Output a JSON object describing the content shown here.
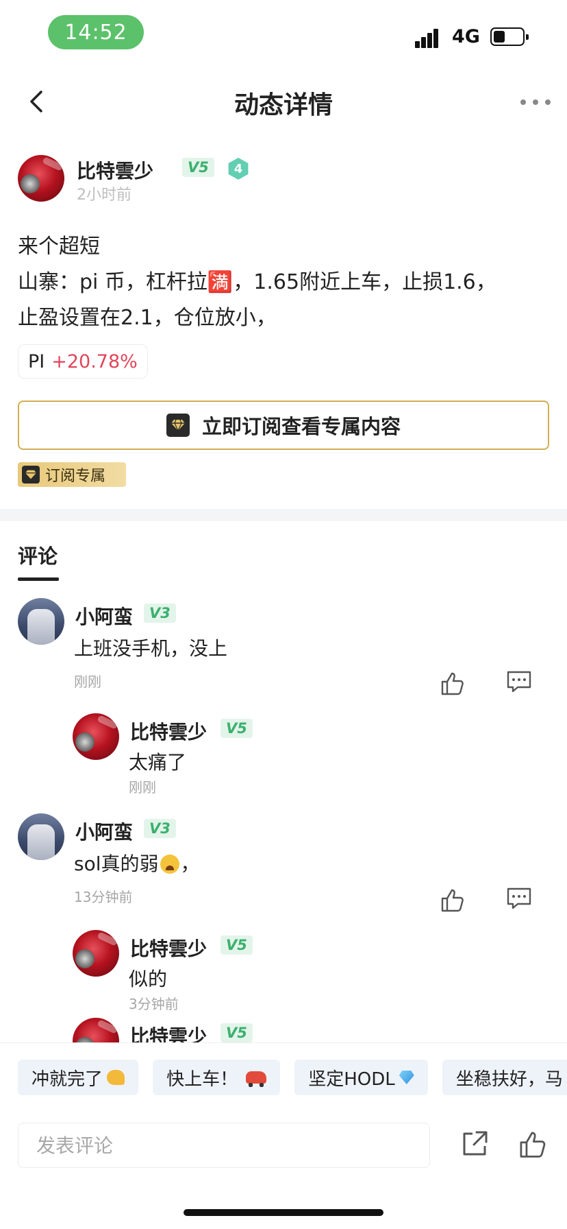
{
  "status_bar": {
    "time": "14:52",
    "network": "4G",
    "battery_percent": 40
  },
  "nav": {
    "title": "动态详情"
  },
  "post": {
    "author": {
      "name": "比特雲少",
      "vip": "V5",
      "level": "4",
      "time": "2小时前"
    },
    "lines": [
      "来个超短",
      "山寨：pi 币，杠杆拉🈵，1.65附近上车，止损1.6，",
      "止盈设置在2.1，仓位放小，"
    ],
    "ticker": {
      "symbol": "PI",
      "change": "+20.78%"
    },
    "subscribe_button": "立即订阅查看专属内容",
    "exclusive_tag": "订阅专属"
  },
  "comments_section": {
    "tab_label": "评论",
    "comments": [
      {
        "name": "小阿蛮",
        "vip": "V3",
        "text": "上班没手机，没上",
        "time": "刚刚",
        "reply": {
          "name": "比特雲少",
          "vip": "V5",
          "text": "太痛了",
          "time": "刚刚"
        }
      },
      {
        "name": "小阿蛮",
        "vip": "V3",
        "text": "sol真的弱",
        "text_suffix": "，",
        "time": "13分钟前",
        "reply": {
          "name": "比特雲少",
          "vip": "V5",
          "text": "似的",
          "time": "3分钟前"
        }
      }
    ],
    "partial_reply": {
      "name": "比特雲少",
      "vip": "V5"
    }
  },
  "bottom": {
    "quick_replies": [
      {
        "label": "冲就完了",
        "emoji": "flexed-biceps-icon"
      },
      {
        "label": "快上车！",
        "emoji": "car-icon"
      },
      {
        "label": "坚定HODL",
        "emoji": "gem-icon"
      },
      {
        "label": "坐稳扶好，马",
        "emoji": ""
      }
    ],
    "comment_placeholder": "发表评论"
  },
  "colors": {
    "accent_green": "#3bb06e",
    "price_up": "#e0465a",
    "gold_border": "#d2ad52",
    "time_pill": "#5bc16a"
  }
}
